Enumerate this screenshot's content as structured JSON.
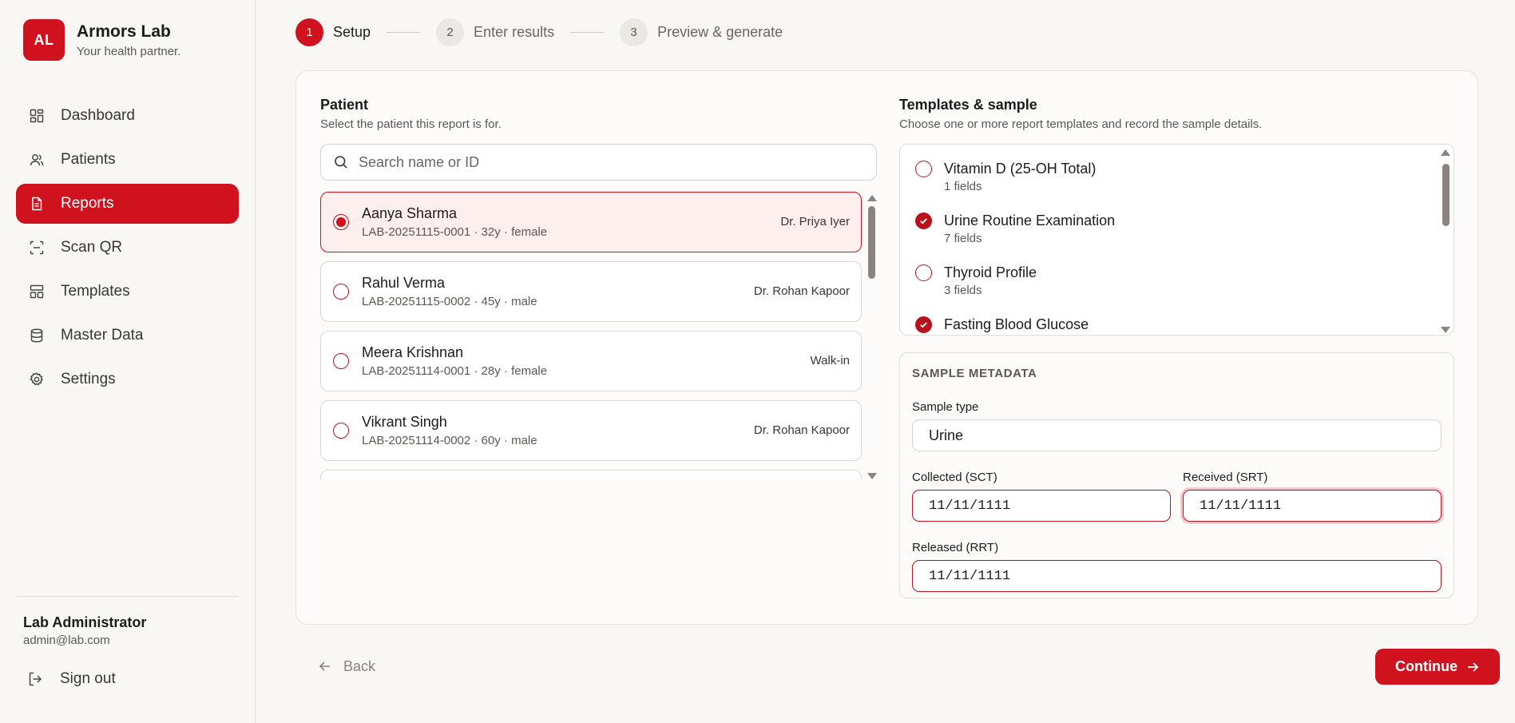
{
  "brand": {
    "logo": "AL",
    "name": "Armors Lab",
    "tagline": "Your health partner."
  },
  "nav": [
    {
      "label": "Dashboard",
      "icon": "dashboard-icon"
    },
    {
      "label": "Patients",
      "icon": "users-icon"
    },
    {
      "label": "Reports",
      "icon": "file-text-icon",
      "active": true
    },
    {
      "label": "Scan QR",
      "icon": "scan-icon"
    },
    {
      "label": "Templates",
      "icon": "layout-icon"
    },
    {
      "label": "Master Data",
      "icon": "database-icon"
    },
    {
      "label": "Settings",
      "icon": "gear-icon"
    }
  ],
  "user": {
    "name": "Lab Administrator",
    "email": "admin@lab.com",
    "signout": "Sign out"
  },
  "stepper": [
    {
      "num": "1",
      "label": "Setup"
    },
    {
      "num": "2",
      "label": "Enter results"
    },
    {
      "num": "3",
      "label": "Preview & generate"
    }
  ],
  "patient": {
    "title": "Patient",
    "subtitle": "Select the patient this report is for.",
    "search_placeholder": "Search name or ID",
    "items": [
      {
        "name": "Aanya Sharma",
        "meta": "LAB-20251115-0001 · 32y · female",
        "doctor": "Dr. Priya Iyer",
        "selected": true
      },
      {
        "name": "Rahul Verma",
        "meta": "LAB-20251115-0002 · 45y · male",
        "doctor": "Dr. Rohan Kapoor"
      },
      {
        "name": "Meera Krishnan",
        "meta": "LAB-20251114-0001 · 28y · female",
        "doctor": "Walk-in"
      },
      {
        "name": "Vikrant Singh",
        "meta": "LAB-20251114-0002 · 60y · male",
        "doctor": "Dr. Rohan Kapoor"
      }
    ]
  },
  "templates": {
    "title": "Templates & sample",
    "subtitle": "Choose one or more report templates and record the sample details.",
    "items": [
      {
        "name": "Vitamin D (25-OH Total)",
        "fields": "1 fields",
        "checked": false
      },
      {
        "name": "Urine Routine Examination",
        "fields": "7 fields",
        "checked": true
      },
      {
        "name": "Thyroid Profile",
        "fields": "3 fields",
        "checked": false
      },
      {
        "name": "Fasting Blood Glucose",
        "fields": "",
        "checked": true
      }
    ]
  },
  "metadata": {
    "title": "SAMPLE METADATA",
    "sample_type_label": "Sample type",
    "sample_type_value": "Urine",
    "collected_label": "Collected (SCT)",
    "collected_value": "11/11/1111",
    "received_label": "Received (SRT)",
    "received_value": "11/11/1111",
    "released_label": "Released (RRT)",
    "released_value": "11/11/1111"
  },
  "actions": {
    "back": "Back",
    "continue": "Continue"
  },
  "colors": {
    "accent": "#d0121e",
    "accent_dark": "#b8131d",
    "selected_bg": "#fcefee"
  }
}
